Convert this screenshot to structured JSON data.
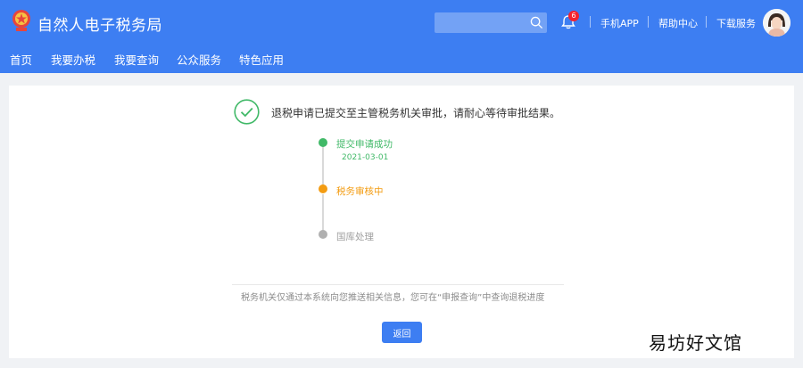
{
  "header": {
    "brand": "自然人电子税务局",
    "search": {
      "placeholder": ""
    },
    "notification_count": "6",
    "links": {
      "app": "手机APP",
      "help": "帮助中心",
      "download": "下载服务"
    }
  },
  "nav": {
    "items": [
      {
        "label": "首页"
      },
      {
        "label": "我要办税"
      },
      {
        "label": "我要查询"
      },
      {
        "label": "公众服务"
      },
      {
        "label": "特色应用"
      }
    ]
  },
  "main": {
    "message": "退税申请已提交至主管税务机关审批，请耐心等待审批结果。",
    "steps": [
      {
        "title": "提交申请成功",
        "date": "2021-03-01",
        "color": "#41b968"
      },
      {
        "title": "税务审核中",
        "color": "#f39c12"
      },
      {
        "title": "国库处理",
        "color": "#b0b0b0"
      }
    ],
    "note": "税务机关仅通过本系统向您推送相关信息，您可在“申报查询”中查询退税进度",
    "back_label": "返回"
  },
  "corner_mark": "易坊好文馆",
  "colors": {
    "header_blue": "#3d7ef2",
    "success_green": "#41b968",
    "pending_orange": "#f39c12",
    "inactive_gray": "#b0b0b0"
  }
}
